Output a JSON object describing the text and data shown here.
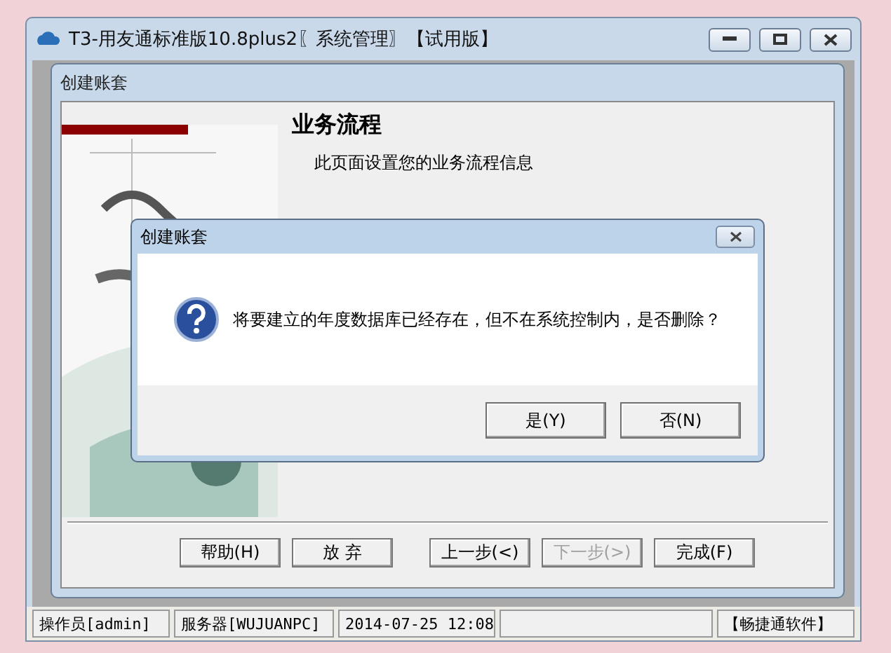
{
  "window": {
    "title": "T3-用友通标准版10.8plus2〖系统管理〗【试用版】"
  },
  "wizard": {
    "title": "创建账套",
    "heading": "业务流程",
    "subtitle": "此页面设置您的业务流程信息",
    "buttons": [
      {
        "label": "帮助(H)",
        "disabled": false
      },
      {
        "label": "放 弃",
        "disabled": false
      },
      {
        "label": "上一步(<)",
        "disabled": false
      },
      {
        "label": "下一步(>)",
        "disabled": true
      },
      {
        "label": "完成(F)",
        "disabled": false
      }
    ]
  },
  "message_box": {
    "title": "创建账套",
    "message": "将要建立的年度数据库已经存在，但不在系统控制内，是否删除？",
    "buttons": [
      "是(Y)",
      "否(N)"
    ]
  },
  "status_bar": {
    "operator": "操作员[admin]",
    "server": "服务器[WUJUANPC]",
    "time": "2014-07-25 12:08",
    "brand": "【畅捷通软件】"
  }
}
